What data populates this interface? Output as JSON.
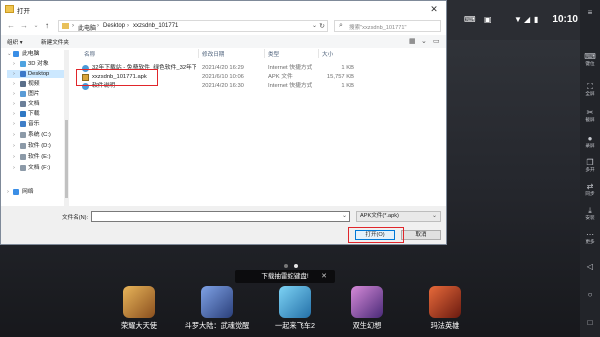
{
  "dialog": {
    "title": "打开",
    "close_icon": "✕",
    "address": {
      "crumbs": [
        "此电脑",
        "Desktop",
        "xxzsdnb_101771"
      ],
      "separator": "›",
      "search_placeholder": "搜索\"xxzsdnb_101771\""
    },
    "toolbar": {
      "organize": "组织 ▾",
      "new_folder": "新建文件夹"
    },
    "nav": [
      {
        "label": "此电脑",
        "icon": "computer-icon",
        "color": "#3a8ee6"
      },
      {
        "label": "3D 对象",
        "icon": "3d-objects-icon",
        "color": "#4fa3e0"
      },
      {
        "label": "Desktop",
        "icon": "desktop-icon",
        "color": "#3b78c9"
      },
      {
        "label": "视频",
        "icon": "video-icon",
        "color": "#5a6f8a"
      },
      {
        "label": "图片",
        "icon": "pictures-icon",
        "color": "#5a9bd6"
      },
      {
        "label": "文档",
        "icon": "documents-icon",
        "color": "#6b7f99"
      },
      {
        "label": "下载",
        "icon": "downloads-icon",
        "color": "#2f78c4"
      },
      {
        "label": "音乐",
        "icon": "music-icon",
        "color": "#3f7ec8"
      },
      {
        "label": "系统 (C:)",
        "icon": "drive-icon",
        "color": "#8c9aa8"
      },
      {
        "label": "软件 (D:)",
        "icon": "drive-icon",
        "color": "#8c9aa8"
      },
      {
        "label": "软件 (E:)",
        "icon": "drive-icon",
        "color": "#8c9aa8"
      },
      {
        "label": "文档 (F:)",
        "icon": "drive-icon",
        "color": "#8c9aa8"
      },
      {
        "label": "网络",
        "icon": "network-icon",
        "color": "#3a8ee6"
      }
    ],
    "columns": [
      "名称",
      "修改日期",
      "类型",
      "大小"
    ],
    "files": [
      {
        "name": "32年下载站 - 免费软件_绿色软件_32年下...",
        "date": "2021/4/20 16:29",
        "type": "Internet 快捷方式",
        "size": "1 KB",
        "icon": "internet-shortcut-icon"
      },
      {
        "name": "xxzsdnb_101771.apk",
        "date": "2021/6/10 10:06",
        "type": "APK 文件",
        "size": "15,757 KB",
        "icon": "apk-file-icon"
      },
      {
        "name": "软件说明",
        "date": "2021/4/20 16:30",
        "type": "Internet 快捷方式",
        "size": "1 KB",
        "icon": "internet-shortcut-icon"
      }
    ],
    "filename_label": "文件名(N):",
    "filename_value": "",
    "filetype_value": "APK文件(*.apk)",
    "open_label": "打开(O)",
    "cancel_label": "取消",
    "highlight_color": "#e0262b"
  },
  "emulator": {
    "time": "10:10",
    "right_bar": [
      {
        "label": "",
        "icon": "menu-icon"
      },
      {
        "label": "键位",
        "icon": "keyboard-icon"
      },
      {
        "label": "全屏",
        "icon": "fullscreen-icon"
      },
      {
        "label": "截屏",
        "icon": "screenshot-icon"
      },
      {
        "label": "录屏",
        "icon": "record-icon"
      },
      {
        "label": "多开",
        "icon": "multi-instance-icon"
      },
      {
        "label": "同步",
        "icon": "sync-icon"
      },
      {
        "label": "安装",
        "icon": "install-icon"
      },
      {
        "label": "更多",
        "icon": "more-icon"
      }
    ],
    "banner": "下载抽雷蛇键盘!",
    "banner_close": "✕",
    "apps": [
      {
        "name": "荣耀大天使",
        "color": "#c98a3a"
      },
      {
        "name": "斗罗大陆：武魂觉醒",
        "color": "#4b6fb8"
      },
      {
        "name": "一起来飞车2",
        "color": "#3aa4d8"
      },
      {
        "name": "双生幻想",
        "color": "#8a5aa8"
      },
      {
        "name": "玛法英雄",
        "color": "#b8452c"
      }
    ]
  }
}
